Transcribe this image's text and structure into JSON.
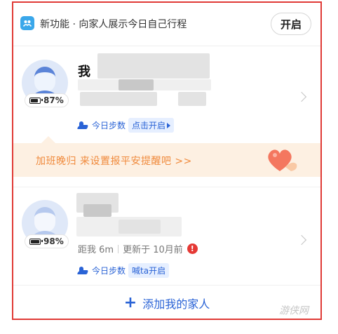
{
  "banner": {
    "icon": "family-share-icon",
    "text": "新功能 · 向家人展示今日自己行程",
    "button": "开启"
  },
  "members": [
    {
      "name": "我",
      "battery": "87%",
      "battery_level": 0.87,
      "steps_label": "今日步数",
      "steps_action": "点击开启"
    },
    {
      "battery": "98%",
      "battery_level": 0.98,
      "distance": "距我 6m",
      "updated": "更新于 10月前",
      "alert": "!",
      "steps_label": "今日步数",
      "steps_action": "喊ta开启"
    }
  ],
  "tip": {
    "text": "加班晚归 来设置报平安提醒吧 >>"
  },
  "add_family": {
    "icon": "+",
    "label": "添加我的家人"
  },
  "watermark": "游侠网",
  "colors": {
    "accent": "#2a63d6",
    "tip_bg": "#fdf0e2",
    "tip_text": "#f08a3c",
    "alert": "#e53935",
    "frame": "#e03a36"
  }
}
